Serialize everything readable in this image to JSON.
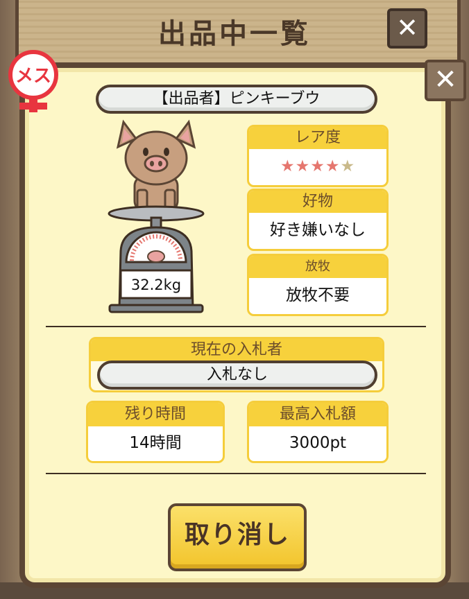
{
  "header": {
    "title": "出品中一覧",
    "close_label": "✕"
  },
  "dialog": {
    "close_label": "✕"
  },
  "gender_badge": {
    "label": "メス",
    "color": "#e8353f"
  },
  "seller": {
    "text": "【出品者】ピンキーブウ"
  },
  "scale": {
    "weight": "32.2kg"
  },
  "rarity": {
    "label": "レア度",
    "stars_filled": 4,
    "stars_total": 5,
    "star_on_color": "#e5766e",
    "star_off_color": "#c9b98a"
  },
  "favorite": {
    "label": "好物",
    "value": "好き嫌いなし"
  },
  "grazing": {
    "label": "放牧",
    "value": "放牧不要"
  },
  "bidder": {
    "label": "現在の入札者",
    "value": "入札なし"
  },
  "time_left": {
    "label": "残り時間",
    "value": "14時間"
  },
  "max_bid": {
    "label": "最高入札額",
    "value": "3000pt"
  },
  "cancel_button": {
    "label": "取り消し"
  }
}
